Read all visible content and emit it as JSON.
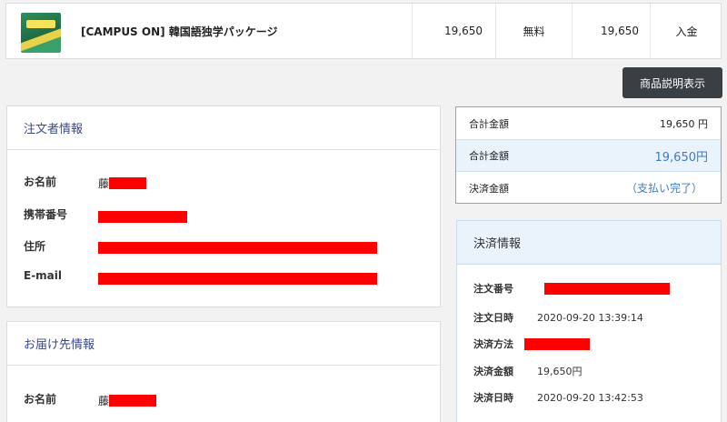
{
  "product": {
    "name": "[CAMPUS ON] 韓国語独学パッケージ",
    "price": "19,650",
    "shipping": "無料",
    "total": "19,650",
    "status": "入金"
  },
  "actions": {
    "description_button": "商品説明表示"
  },
  "orderer": {
    "title": "注文者情報",
    "fields": [
      {
        "label": "お名前",
        "value_prefix": "藤"
      },
      {
        "label": "携帯番号",
        "value_prefix": ""
      },
      {
        "label": "住所",
        "value_prefix": ""
      },
      {
        "label": "E-mail",
        "value_prefix": ""
      }
    ]
  },
  "delivery": {
    "title": "お届け先情報",
    "fields": [
      {
        "label": "お名前",
        "value_prefix": "藤"
      }
    ]
  },
  "totals": {
    "rows": [
      {
        "label": "合計金額",
        "value": "19,650 円"
      },
      {
        "label": "合計金額",
        "value": "19,650円"
      },
      {
        "label": "決済金額",
        "value": "（支払い完了）"
      }
    ]
  },
  "payment": {
    "title": "決済情報",
    "rows": [
      {
        "label": "注文番号",
        "value": ""
      },
      {
        "label": "注文日時",
        "value": "2020-09-20 13:39:14"
      },
      {
        "label": "決済方法",
        "value": ""
      },
      {
        "label": "決済金額",
        "value": "19,650円"
      },
      {
        "label": "決済日時",
        "value": "2020-09-20 13:42:53"
      }
    ]
  },
  "colors": {
    "redaction": "#ff0000",
    "accent_blue": "#3d7cc9",
    "heading_navy": "#3a4a8c",
    "button_dark": "#3a3f44"
  }
}
